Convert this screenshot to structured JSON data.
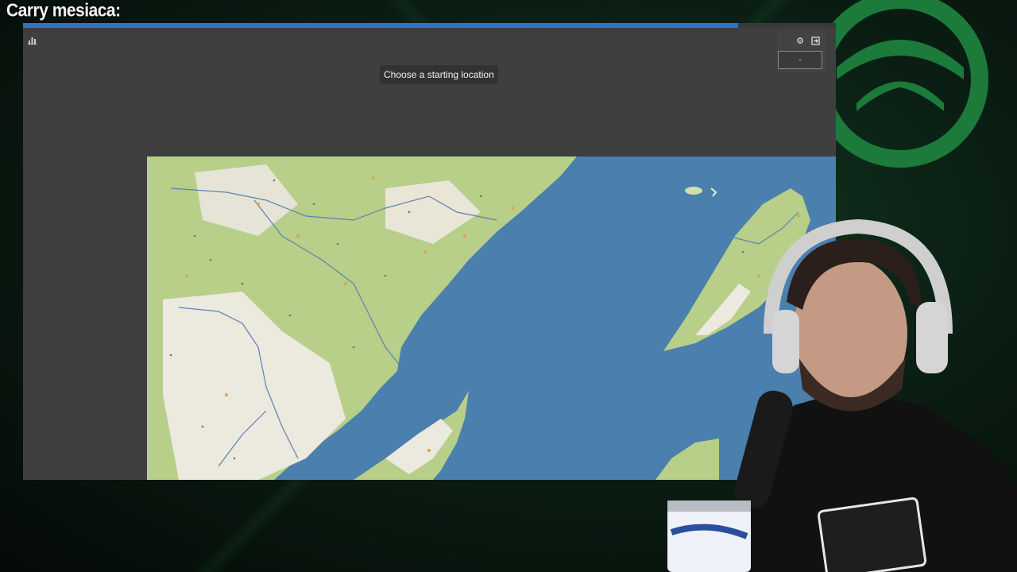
{
  "stream": {
    "overlay_title": "Carry mesiaca:"
  },
  "game": {
    "progress": 0.88,
    "prompt": "Choose a starting location",
    "top_panel": {
      "settings_icon": "gear-icon",
      "exit_icon": "exit-icon",
      "value_text": "-"
    },
    "stats_icon": "chart-icon"
  },
  "colors": {
    "progress_bar": "#2f74c9",
    "window_bg": "#3f3f3f",
    "water": "#4a7fae",
    "land": "#b9d18a"
  }
}
